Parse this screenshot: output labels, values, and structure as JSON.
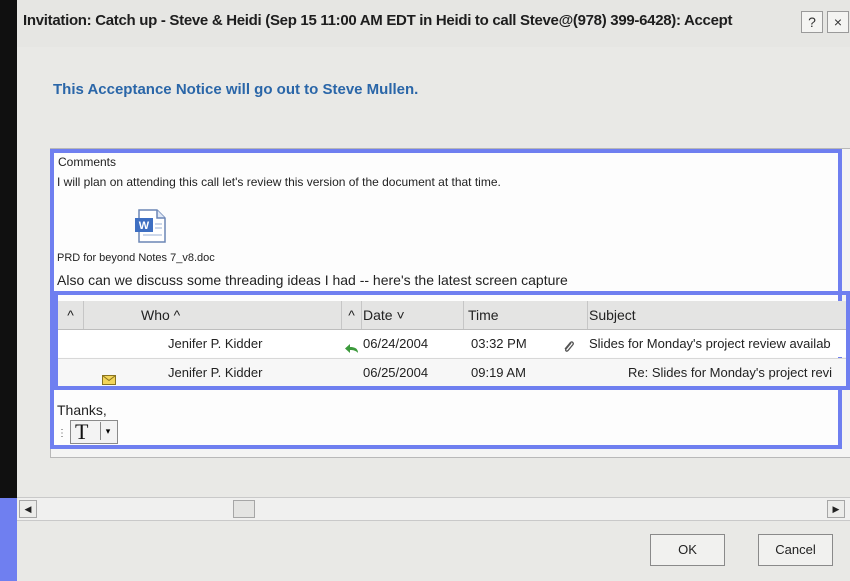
{
  "window": {
    "title": "Invitation: Catch up - Steve & Heidi (Sep 15 11:00 AM EDT in Heidi to call Steve@(978) 399-6428): Accept",
    "help_label": "?",
    "close_label": "×"
  },
  "notice": "This Acceptance Notice will go out to Steve Mullen.",
  "comments": {
    "label": "Comments",
    "line1": "I will plan on attending this call let's review this version of the document at that time.",
    "attachment_name": "PRD for beyond Notes 7_v8.doc",
    "line2": "Also can we discuss some threading ideas I had -- here's the latest screen capture",
    "thanks": "Thanks,",
    "font_label": "T"
  },
  "list": {
    "columns": [
      "Who ^",
      "Date ˅",
      "Time",
      "Subject"
    ],
    "sort_glyph": "^",
    "rows": [
      {
        "who": "Jenifer P. Kidder",
        "date": "06/24/2004",
        "time": "03:32 PM",
        "subject": "Slides for Monday's project review availab"
      },
      {
        "who": "Jenifer P. Kidder",
        "date": "06/25/2004",
        "time": "09:19 AM",
        "subject": "Re: Slides for Monday's project revi"
      }
    ]
  },
  "buttons": {
    "ok": "OK",
    "cancel": "Cancel"
  },
  "icons": [
    "word-doc-icon",
    "reply-arrow-icon",
    "paperclip-icon",
    "envelope-icon",
    "scroll-left-icon",
    "scroll-right-icon"
  ],
  "colors": {
    "highlight": "#6f7ff0",
    "notice_text": "#2a66a8"
  }
}
